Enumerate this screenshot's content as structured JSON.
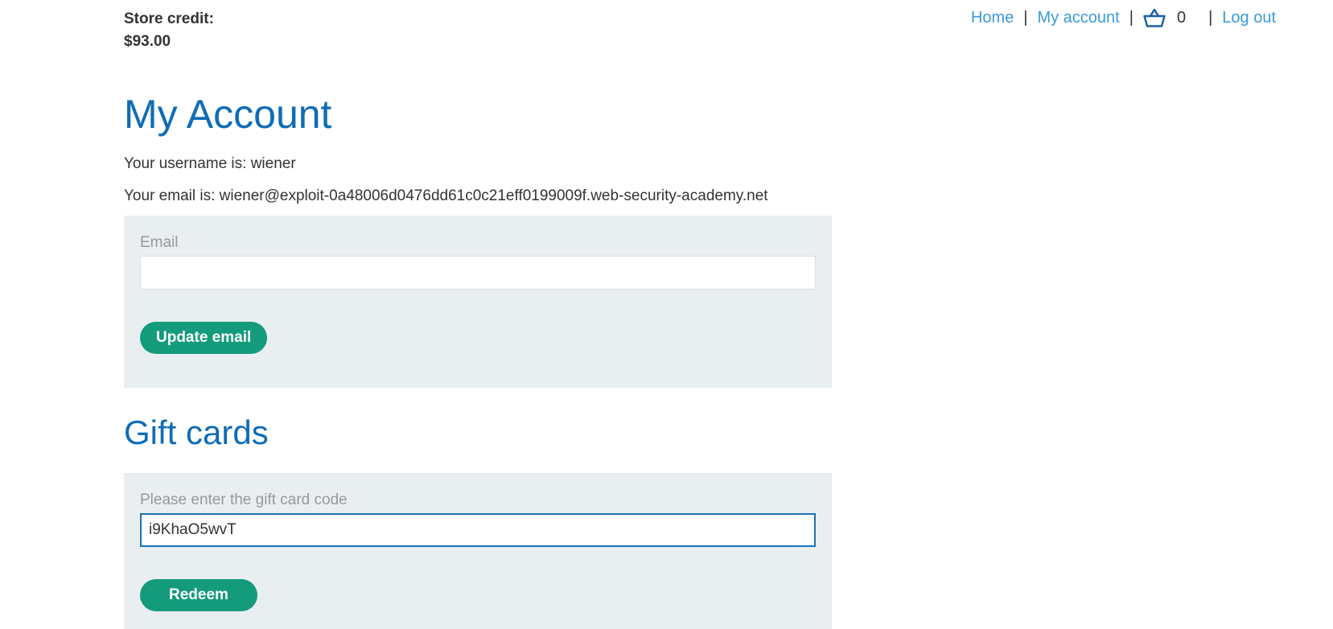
{
  "store_credit": {
    "label": "Store credit:",
    "amount": "$93.00"
  },
  "nav": {
    "home": "Home",
    "separator": "|",
    "my_account": "My account",
    "cart_icon": "shopping-basket-icon",
    "cart_count": "0",
    "log_out": "Log out",
    "link_color": "#3b9ad9"
  },
  "main": {
    "title": "My Account",
    "username_line": "Your username is: wiener",
    "email_line": "Your email is: wiener@exploit-0a48006d0476dd61c0c21eff0199009f.web-security-academy.net",
    "email_form": {
      "label": "Email",
      "value": "",
      "button": "Update email"
    },
    "gift_section_title": "Gift cards",
    "gift_form": {
      "label": "Please enter the gift card code",
      "value": "i9KhaO5wvT",
      "button": "Redeem"
    }
  },
  "colors": {
    "heading": "#0f6cb5",
    "button": "#149b7b",
    "form_background": "#e9eef1"
  }
}
